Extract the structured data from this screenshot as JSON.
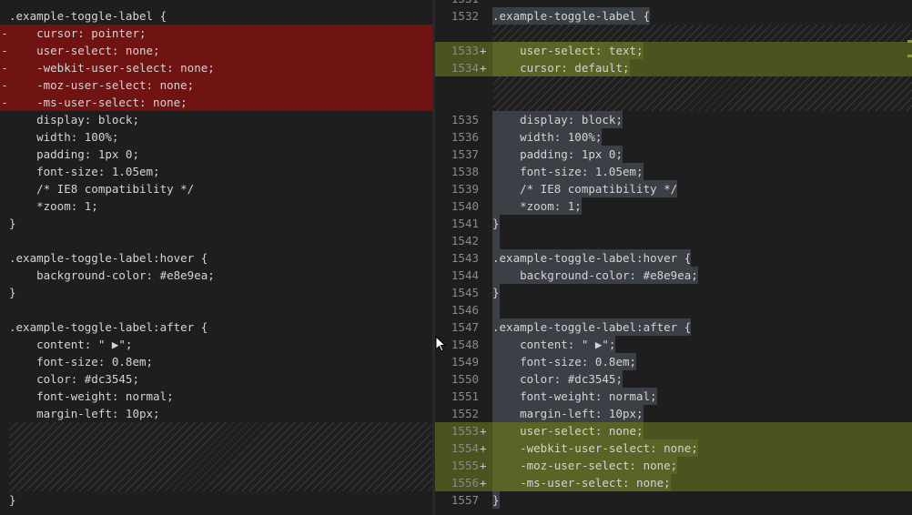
{
  "left": {
    "lines": [
      {
        "text": ".example-toggle-label {",
        "removed": false
      },
      {
        "marker": "-",
        "text": "    cursor: pointer;",
        "removed": true
      },
      {
        "marker": "-",
        "text": "    user-select: none;",
        "removed": true
      },
      {
        "marker": "-",
        "text": "    -webkit-user-select: none;",
        "removed": true
      },
      {
        "marker": "-",
        "text": "    -moz-user-select: none;",
        "removed": true
      },
      {
        "marker": "-",
        "text": "    -ms-user-select: none;",
        "removed": true
      },
      {
        "text": "    display: block;",
        "removed": false
      },
      {
        "text": "    width: 100%;",
        "removed": false
      },
      {
        "text": "    padding: 1px 0;",
        "removed": false
      },
      {
        "text": "    font-size: 1.05em;",
        "removed": false
      },
      {
        "text": "    /* IE8 compatibility */",
        "removed": false
      },
      {
        "text": "    *zoom: 1;",
        "removed": false
      },
      {
        "text": "}",
        "removed": false
      },
      {
        "text": "",
        "removed": false
      },
      {
        "text": ".example-toggle-label:hover {",
        "removed": false
      },
      {
        "text": "    background-color: #e8e9ea;",
        "removed": false
      },
      {
        "text": "}",
        "removed": false
      },
      {
        "text": "",
        "removed": false
      },
      {
        "text": ".example-toggle-label:after {",
        "removed": false
      },
      {
        "text": "    content: \" ▶\";",
        "removed": false
      },
      {
        "text": "    font-size: 0.8em;",
        "removed": false
      },
      {
        "text": "    color: #dc3545;",
        "removed": false
      },
      {
        "text": "    font-weight: normal;",
        "removed": false
      },
      {
        "text": "    margin-left: 10px;",
        "removed": false
      }
    ],
    "last_line": "}"
  },
  "right": {
    "top_partial_number": "1531",
    "lines": [
      {
        "num": "1532",
        "text": ".example-toggle-label {",
        "added": false
      },
      {
        "num": "1533",
        "plus": "+",
        "text": "    user-select: text;",
        "added": true
      },
      {
        "num": "1534",
        "plus": "+",
        "text": "    cursor: default;",
        "added": true
      },
      {
        "num": "1535",
        "text": "    display: block;",
        "added": false
      },
      {
        "num": "1536",
        "text": "    width: 100%;",
        "added": false
      },
      {
        "num": "1537",
        "text": "    padding: 1px 0;",
        "added": false
      },
      {
        "num": "1538",
        "text": "    font-size: 1.05em;",
        "added": false
      },
      {
        "num": "1539",
        "text": "    /* IE8 compatibility */",
        "added": false
      },
      {
        "num": "1540",
        "text": "    *zoom: 1;",
        "added": false
      },
      {
        "num": "1541",
        "text": "}",
        "added": false
      },
      {
        "num": "1542",
        "text": "",
        "added": false
      },
      {
        "num": "1543",
        "text": ".example-toggle-label:hover {",
        "added": false
      },
      {
        "num": "1544",
        "text": "    background-color: #e8e9ea;",
        "added": false
      },
      {
        "num": "1545",
        "text": "}",
        "added": false
      },
      {
        "num": "1546",
        "text": "",
        "added": false
      },
      {
        "num": "1547",
        "text": ".example-toggle-label:after {",
        "added": false
      },
      {
        "num": "1548",
        "text": "    content: \" ▶\";",
        "added": false
      },
      {
        "num": "1549",
        "text": "    font-size: 0.8em;",
        "added": false
      },
      {
        "num": "1550",
        "text": "    color: #dc3545;",
        "added": false
      },
      {
        "num": "1551",
        "text": "    font-weight: normal;",
        "added": false
      },
      {
        "num": "1552",
        "text": "    margin-left: 10px;",
        "added": false
      },
      {
        "num": "1553",
        "plus": "+",
        "text": "    user-select: none;",
        "added": true
      },
      {
        "num": "1554",
        "plus": "+",
        "text": "    -webkit-user-select: none;",
        "added": true
      },
      {
        "num": "1555",
        "plus": "+",
        "text": "    -moz-user-select: none;",
        "added": true
      },
      {
        "num": "1556",
        "plus": "+",
        "text": "    -ms-user-select: none;",
        "added": true
      },
      {
        "num": "1557",
        "text": "}",
        "added": false
      }
    ]
  },
  "colors": {
    "removed_bg": "#6f1313",
    "added_bg": "#4b5320",
    "selection_bg": "#3b3f46",
    "editor_bg": "#1e1e1e"
  }
}
